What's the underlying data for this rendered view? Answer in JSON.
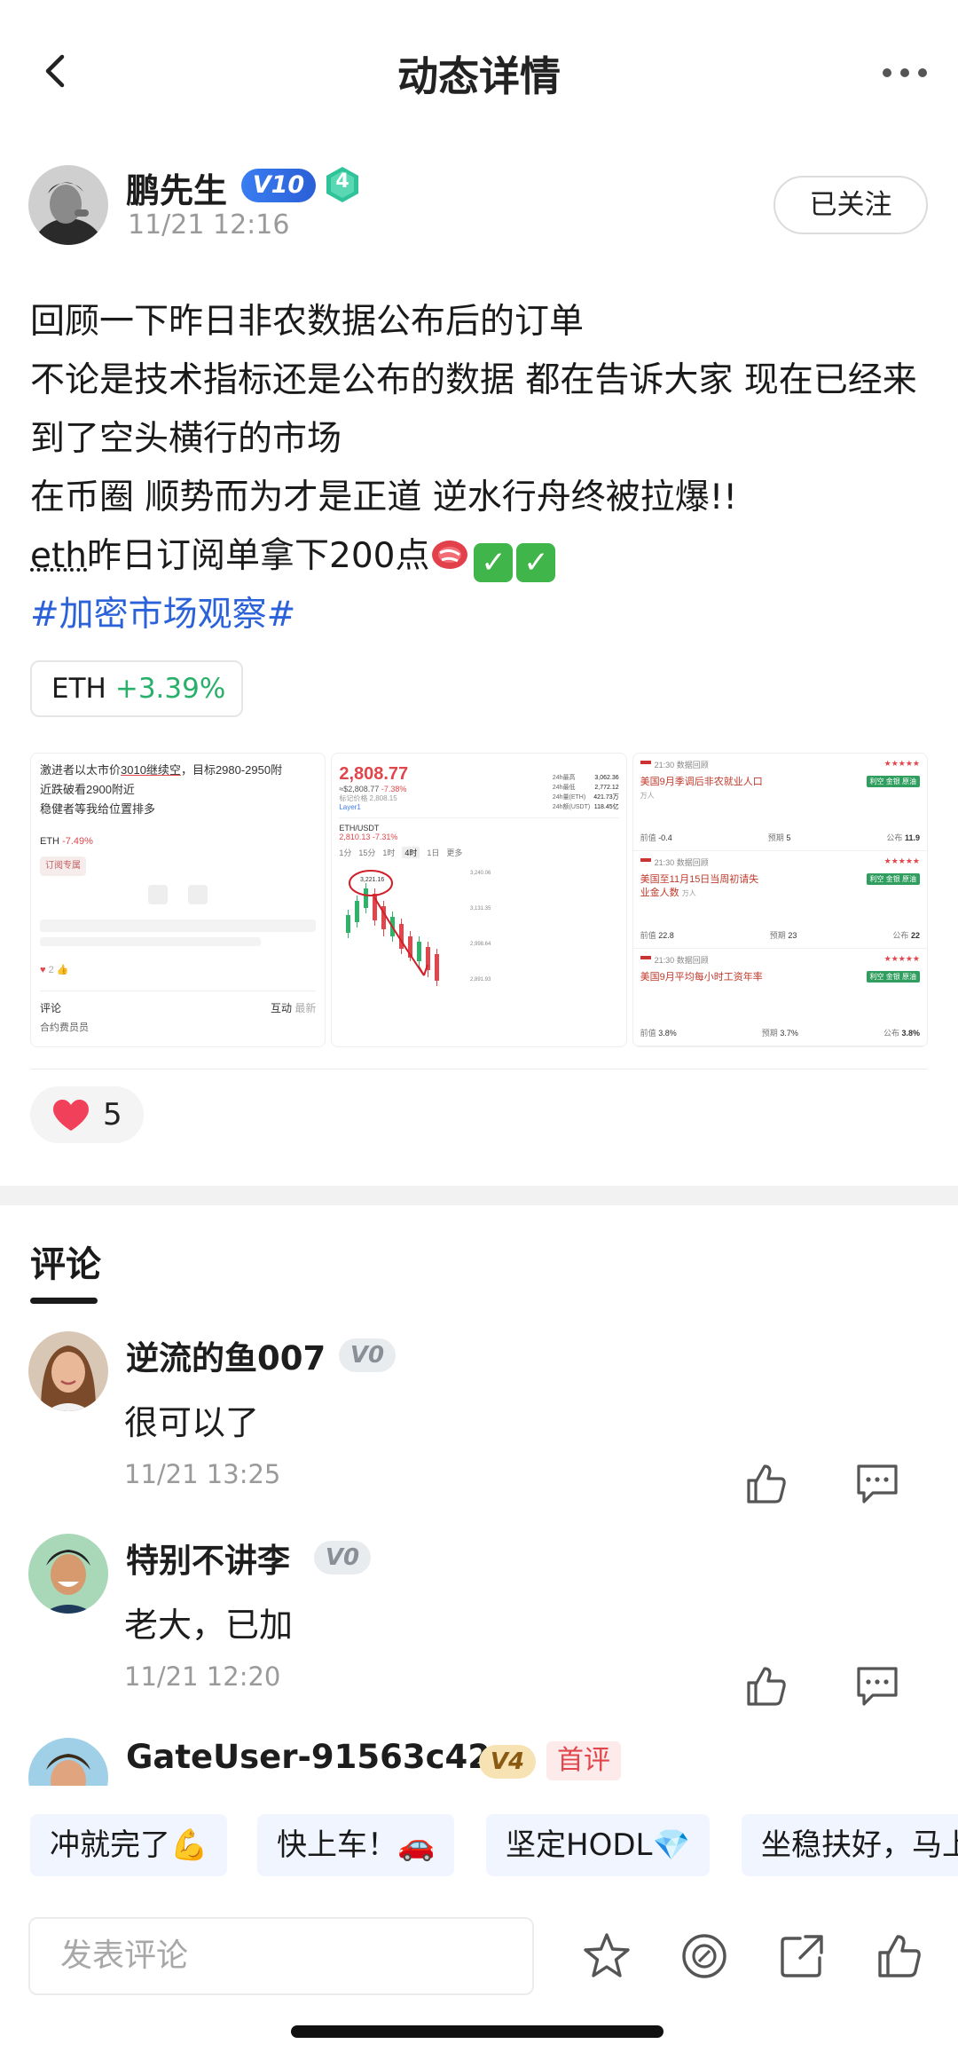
{
  "header": {
    "title": "动态详情"
  },
  "author": {
    "name": "鹏先生",
    "vip": "V10",
    "level_badge": "4",
    "time": "11/21 12:16",
    "follow_label": "已关注"
  },
  "post": {
    "line1": "回顾一下昨日非农数据公布后的订单",
    "line2": "不论是技术指标还是公布的数据 都在告诉大家 现在已经来到了空头横行的市场",
    "line3": "在币圈 顺势而为才是正道 逆水行舟终被拉爆!!",
    "line4_a": "eth",
    "line4_b": "昨日订阅单拿下200点",
    "hashtag": "#加密市场观察#"
  },
  "coin_tag": {
    "symbol": "ETH",
    "change": "+3.39%"
  },
  "images": {
    "img1": {
      "l1a": "激进者以太市价",
      "l1b": "3010继续空",
      "l1c": "，目标2980-2950附",
      "l2": "近跌破看2900附近",
      "l3": "稳健者等我给位置排多",
      "tag": "ETH",
      "tag_pct": "-7.49%",
      "sub": "订阅专属",
      "comment": "评论",
      "interact": "互动",
      "latest": "最新",
      "commenter": "合约费员员"
    },
    "img2": {
      "price": "2,808.77",
      "sub_price": "≈$2,808.77",
      "sub_pct": "-7.38%",
      "mark": "标记价格 2,808.15",
      "l2": "Layer1",
      "stats": [
        "24h最高",
        "24h最低",
        "24h量(ETH)",
        "24h额(USDT)"
      ],
      "stat_vals": [
        "3,062.36",
        "2,772.12",
        "421.73万",
        "118.45亿"
      ],
      "pair": "ETH/USDT",
      "pair_price": "2,810.13",
      "pair_pct": "-7.31%",
      "intervals": [
        "1分",
        "15分",
        "1时",
        "4时",
        "1日",
        "更多"
      ],
      "annot": "3,221.16",
      "axis": [
        "3,240.06",
        "3,131.35",
        "2,998.64",
        "2,891.93"
      ]
    },
    "img3": {
      "rows": [
        {
          "time": "21:30",
          "src": "数据回顾",
          "title": "美国9月季调后非农就业人口",
          "unit": "万人",
          "prev_label": "前值",
          "prev": "-0.4",
          "fcst_label": "预期",
          "fcst": "5",
          "act_label": "公布",
          "act": "11.9",
          "tag": "利空 金银 原油"
        },
        {
          "time": "21:30",
          "src": "数据回顾",
          "title": "美国至11月15日当周初请失业金人数",
          "unit": "万人",
          "prev_label": "前值",
          "prev": "22.8",
          "fcst_label": "预期",
          "fcst": "23",
          "act_label": "公布",
          "act": "22",
          "tag": "利空 金银 原油"
        },
        {
          "time": "21:30",
          "src": "数据回顾",
          "title": "美国9月平均每小时工资年率",
          "unit": "",
          "prev_label": "前值",
          "prev": "3.8%",
          "fcst_label": "预期",
          "fcst": "3.7%",
          "act_label": "公布",
          "act": "3.8%",
          "tag": "利空 金银 原油"
        }
      ]
    }
  },
  "likes": {
    "count": "5"
  },
  "comments_tab": {
    "label": "评论"
  },
  "comments": [
    {
      "name": "逆流的鱼007",
      "level": "V0",
      "text": "很可以了",
      "time": "11/21 13:25"
    },
    {
      "name": "特别不讲李",
      "level": "V0",
      "text": "老大，已加",
      "time": "11/21 12:20"
    },
    {
      "name": "GateUser-91563c42",
      "level": "V4",
      "first_tag": "首评"
    }
  ],
  "quick_replies": [
    "冲就完了💪",
    "快上车！🚗",
    "坚定HODL💎",
    "坐稳扶好，马上"
  ],
  "input": {
    "placeholder": "发表评论"
  },
  "colors": {
    "accent_blue": "#2c62d9",
    "positive": "#28b06a",
    "negative": "#e0464b",
    "like_red": "#f0405a"
  },
  "icons": [
    "back-arrow-icon",
    "more-icon",
    "level-hex-icon",
    "heart-icon",
    "thumbs-up-icon",
    "reply-bubble-icon",
    "star-icon",
    "coin-icon",
    "share-icon"
  ]
}
